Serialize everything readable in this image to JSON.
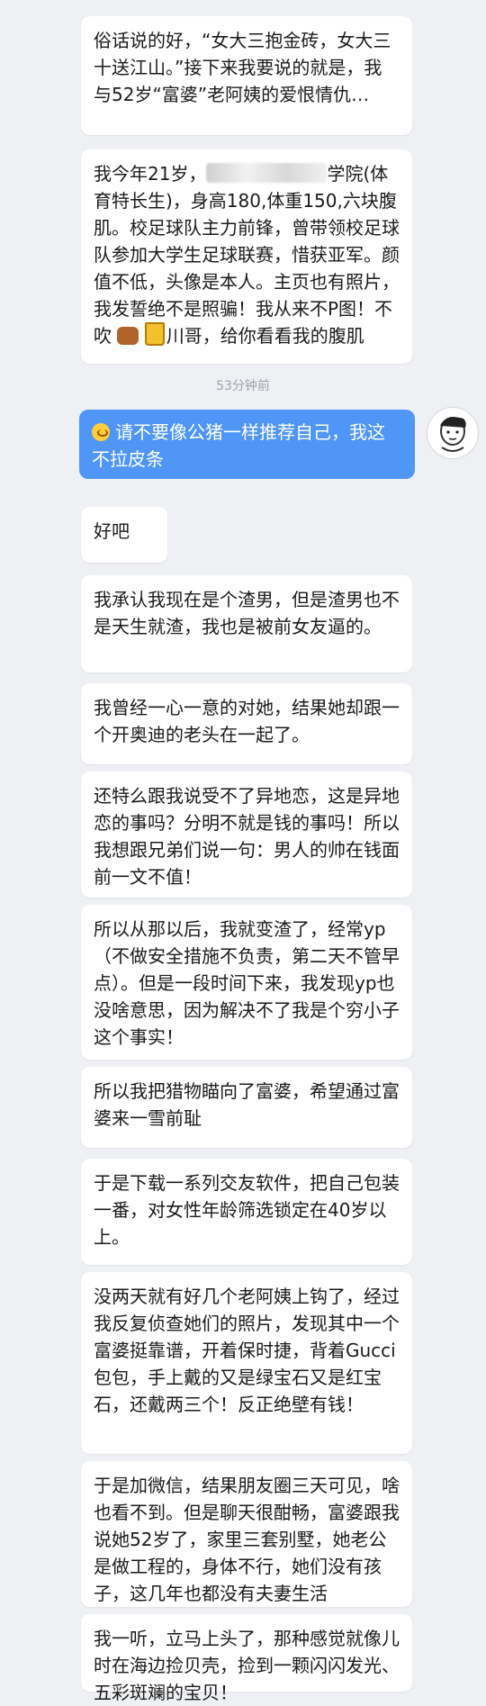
{
  "messages": [
    {
      "text": "俗话说的好，“女大三抱金砖，女大三十送江山。”接下来我要说的就是，我与52岁“富婆”老阿姨的爱恨情仇…"
    },
    {
      "prefix": "我今年21岁，",
      "suffix": "学院(体育特长生)，身高180,体重150,六块腹肌。校足球队主力前锋，曾带领校足球队参加大学生足球联赛，惜获亚军。颜值不低，头像是本人。主页也有照片，我发誓绝不是照骗！我从来不P图！不吹",
      "mid": "川哥，给你看看我的腹肌"
    },
    {
      "text": "好吧"
    },
    {
      "text": "我承认我现在是个渣男，但是渣男也不是天生就渣，我也是被前女友逼的。"
    },
    {
      "text": "我曾经一心一意的对她，结果她却跟一个开奥迪的老头在一起了。"
    },
    {
      "text": "还特么跟我说受不了异地恋，这是异地恋的事吗？分明不就是钱的事吗！所以我想跟兄弟们说一句：男人的帅在钱面前一文不值！"
    },
    {
      "text": "所以从那以后，我就变渣了，经常yp（不做安全措施不负责，第二天不管早点）。但是一段时间下来，我发现yp也没啥意思，因为解决不了我是个穷小子这个事实！"
    },
    {
      "text": "所以我把猎物瞄向了富婆，希望通过富婆来一雪前耻"
    },
    {
      "text": "于是下载一系列交友软件，把自己包装一番，对女性年龄筛选锁定在40岁以上。"
    },
    {
      "text": "没两天就有好几个老阿姨上钩了，经过我反复侦查她们的照片，发现其中一个富婆挺靠谱，开着保时捷，背着Gucci包包，手上戴的又是绿宝石又是红宝石，还戴两三个！反正绝壁有钱！"
    },
    {
      "text": "于是加微信，结果朋友圈三天可见，啥也看不到。但是聊天很酣畅，富婆跟我说她52岁了，家里三套别墅，她老公是做工程的，身体不行，她们没有孩子，这几年也都没有夫妻生活"
    },
    {
      "text": "我一听，立马上头了，那种感觉就像儿时在海边捡贝壳，捡到一颗闪闪发光、五彩斑斓的宝贝！"
    }
  ],
  "timestamp": "53分钟前",
  "my_message": "请不要像公猪一样推荐自己，我这不拉皮条",
  "colors": {
    "me_bubble": "#4f96f7",
    "background": "#eef0f4",
    "bubble": "#ffffff"
  },
  "icons": [
    "cow-emoji-icon",
    "beer-emoji-icon",
    "sweat-emoji-icon",
    "avatar-icon"
  ]
}
